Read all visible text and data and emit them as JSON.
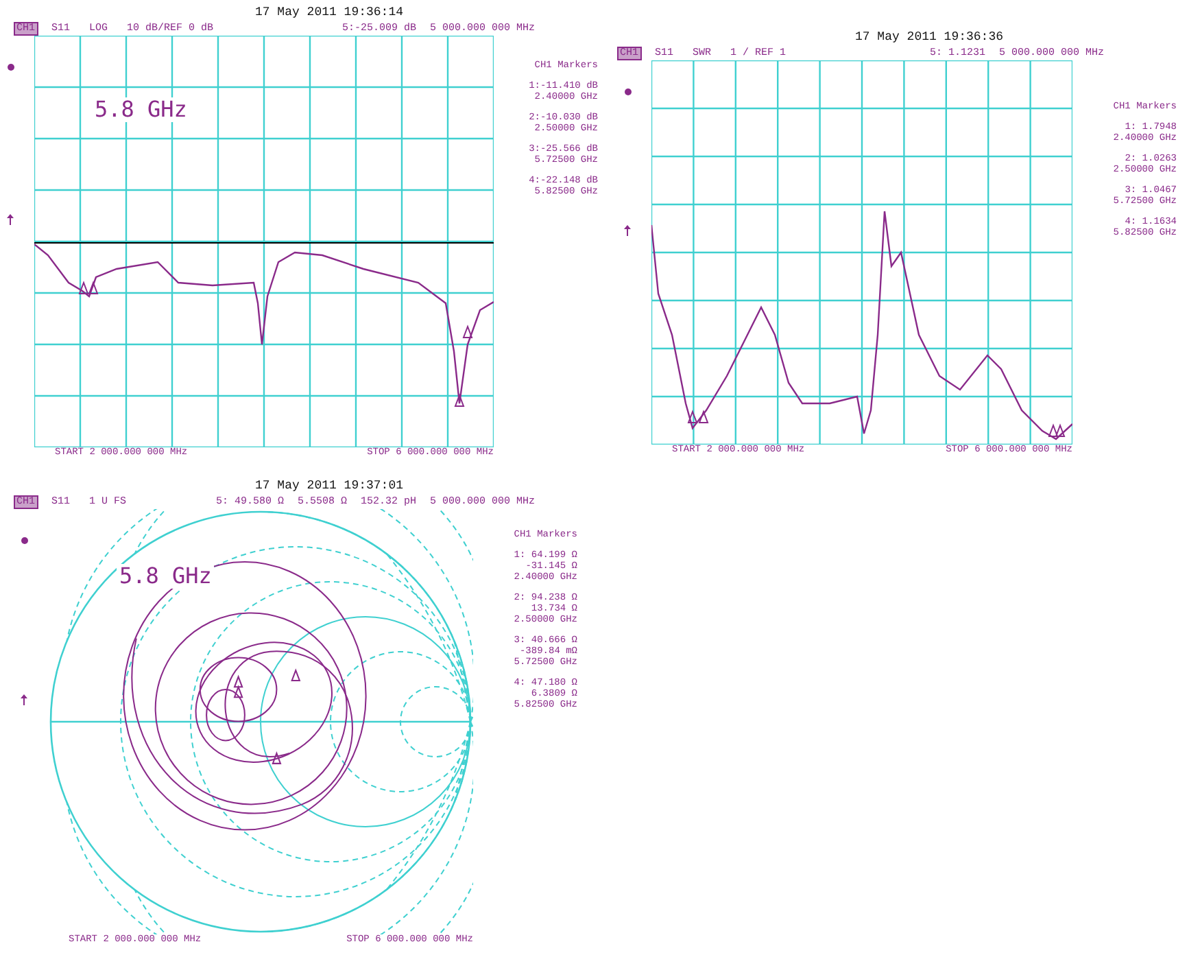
{
  "panels": [
    {
      "kind": "log",
      "date": "17 May 2011  19:36:14",
      "channel": "CH1",
      "header_left": [
        "S11",
        "LOG",
        "10 dB/REF 0 dB"
      ],
      "header_right": [
        "5:-25.009 dB",
        "5 000.000 000 MHz"
      ],
      "note": "5.8 GHz",
      "markers_title": "CH1 Markers",
      "markers": [
        [
          "1:-11.410 dB",
          "2.40000 GHz"
        ],
        [
          "2:-10.030 dB",
          "2.50000 GHz"
        ],
        [
          "3:-25.566 dB",
          "5.72500 GHz"
        ],
        [
          "4:-22.148 dB",
          "5.82500 GHz"
        ]
      ],
      "start": "START 2 000.000 000 MHz",
      "stop": "STOP 6 000.000 000 MHz"
    },
    {
      "kind": "swr",
      "date": "17 May 2011  19:36:36",
      "channel": "CH1",
      "header_left": [
        "S11",
        "SWR",
        "1 / REF 1"
      ],
      "header_right": [
        "5: 1.1231",
        "5 000.000 000 MHz"
      ],
      "markers_title": "CH1 Markers",
      "markers": [
        [
          "1: 1.7948",
          "2.40000 GHz"
        ],
        [
          "2: 1.0263",
          "2.50000 GHz"
        ],
        [
          "3: 1.0467",
          "5.72500 GHz"
        ],
        [
          "4: 1.1634",
          "5.82500 GHz"
        ]
      ],
      "start": "START 2 000.000 000 MHz",
      "stop": "STOP 6 000.000 000 MHz"
    },
    {
      "kind": "smith",
      "date": "17 May 2011  19:37:01",
      "channel": "CH1",
      "header_left": [
        "S11",
        "1 U FS"
      ],
      "header_right": [
        "5: 49.580 Ω",
        "5.5508 Ω",
        "152.32 pH",
        "5 000.000 000 MHz"
      ],
      "note": "5.8 GHz",
      "markers_title": "CH1 Markers",
      "markers": [
        [
          "1: 64.199 Ω",
          "-31.145 Ω",
          "2.40000 GHz"
        ],
        [
          "2: 94.238 Ω",
          "13.734 Ω",
          "2.50000 GHz"
        ],
        [
          "3: 40.666 Ω",
          "-389.84 mΩ",
          "5.72500 GHz"
        ],
        [
          "4: 47.180 Ω",
          "6.3809 Ω",
          "5.82500 GHz"
        ]
      ],
      "start": "START 2 000.000 000 MHz",
      "stop": "STOP 6 000.000 000 MHz"
    }
  ]
}
